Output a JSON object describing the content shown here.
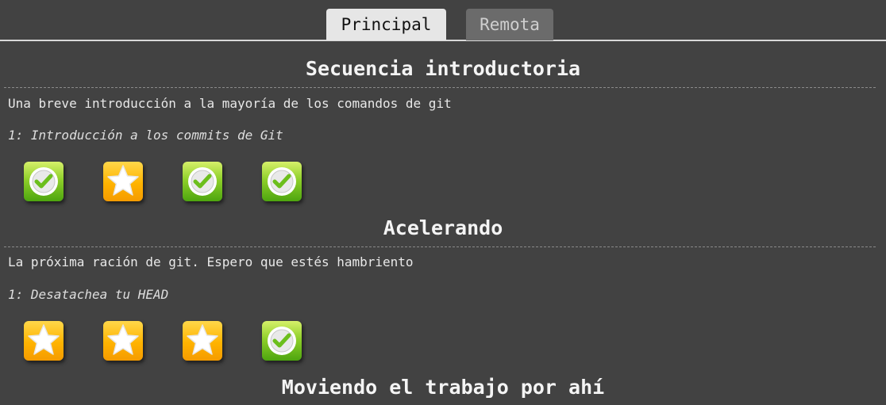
{
  "tabs": {
    "main": "Principal",
    "remote": "Remota"
  },
  "sections": [
    {
      "title": "Secuencia introductoria",
      "description": "Una breve introducción a la mayoría de los comandos de git",
      "level_name": "1: Introducción a los commits de Git",
      "levels": [
        {
          "icon": "check-icon",
          "status": "completed"
        },
        {
          "icon": "star-icon",
          "status": "pending"
        },
        {
          "icon": "check-icon",
          "status": "completed"
        },
        {
          "icon": "check-icon",
          "status": "completed"
        }
      ]
    },
    {
      "title": "Acelerando",
      "description": "La próxima ración de git. Espero que estés hambriento",
      "level_name": "1: Desatachea tu HEAD",
      "levels": [
        {
          "icon": "star-icon",
          "status": "pending"
        },
        {
          "icon": "star-icon",
          "status": "pending"
        },
        {
          "icon": "star-icon",
          "status": "pending"
        },
        {
          "icon": "check-icon",
          "status": "completed"
        }
      ]
    },
    {
      "title": "Moviendo el trabajo por ahí"
    }
  ],
  "colors": {
    "background": "#424242",
    "star_gold": "#ffb300",
    "check_green": "#6cbf1c"
  }
}
